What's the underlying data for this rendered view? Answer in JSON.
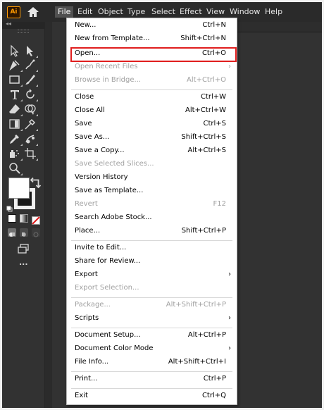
{
  "app": {
    "logo_text": "Ai",
    "menus": [
      "File",
      "Edit",
      "Object",
      "Type",
      "Select",
      "Effect",
      "View",
      "Window",
      "Help"
    ],
    "active_menu": "File"
  },
  "file_menu": {
    "items": [
      {
        "label": "New...",
        "shortcut": "Ctrl+N",
        "enabled": true
      },
      {
        "label": "New from Template...",
        "shortcut": "Shift+Ctrl+N",
        "enabled": true
      },
      {
        "label": "Open...",
        "shortcut": "Ctrl+O",
        "enabled": true,
        "highlighted": true
      },
      {
        "label": "Open Recent Files",
        "shortcut": "",
        "enabled": false,
        "submenu": true
      },
      {
        "label": "Browse in Bridge...",
        "shortcut": "Alt+Ctrl+O",
        "enabled": false
      },
      {
        "label": "Close",
        "shortcut": "Ctrl+W",
        "enabled": true
      },
      {
        "label": "Close All",
        "shortcut": "Alt+Ctrl+W",
        "enabled": true
      },
      {
        "label": "Save",
        "shortcut": "Ctrl+S",
        "enabled": true
      },
      {
        "label": "Save As...",
        "shortcut": "Shift+Ctrl+S",
        "enabled": true
      },
      {
        "label": "Save a Copy...",
        "shortcut": "Alt+Ctrl+S",
        "enabled": true
      },
      {
        "label": "Save Selected Slices...",
        "shortcut": "",
        "enabled": false
      },
      {
        "label": "Version History",
        "shortcut": "",
        "enabled": true
      },
      {
        "label": "Save as Template...",
        "shortcut": "",
        "enabled": true
      },
      {
        "label": "Revert",
        "shortcut": "F12",
        "enabled": false
      },
      {
        "label": "Search Adobe Stock...",
        "shortcut": "",
        "enabled": true
      },
      {
        "label": "Place...",
        "shortcut": "Shift+Ctrl+P",
        "enabled": true
      },
      {
        "label": "Invite to Edit...",
        "shortcut": "",
        "enabled": true
      },
      {
        "label": "Share for Review...",
        "shortcut": "",
        "enabled": true
      },
      {
        "label": "Export",
        "shortcut": "",
        "enabled": true,
        "submenu": true
      },
      {
        "label": "Export Selection...",
        "shortcut": "",
        "enabled": false
      },
      {
        "label": "Package...",
        "shortcut": "Alt+Shift+Ctrl+P",
        "enabled": false
      },
      {
        "label": "Scripts",
        "shortcut": "",
        "enabled": true,
        "submenu": true
      },
      {
        "label": "Document Setup...",
        "shortcut": "Alt+Ctrl+P",
        "enabled": true
      },
      {
        "label": "Document Color Mode",
        "shortcut": "",
        "enabled": true,
        "submenu": true
      },
      {
        "label": "File Info...",
        "shortcut": "Alt+Shift+Ctrl+I",
        "enabled": true
      },
      {
        "label": "Print...",
        "shortcut": "Ctrl+P",
        "enabled": true
      },
      {
        "label": "Exit",
        "shortcut": "Ctrl+Q",
        "enabled": true
      }
    ]
  },
  "toolbar": {
    "more_tools": "..."
  },
  "colors": {
    "highlight_border": "#e01e1e",
    "logo_accent": "#ff9a00",
    "panel_bg": "#323232"
  }
}
